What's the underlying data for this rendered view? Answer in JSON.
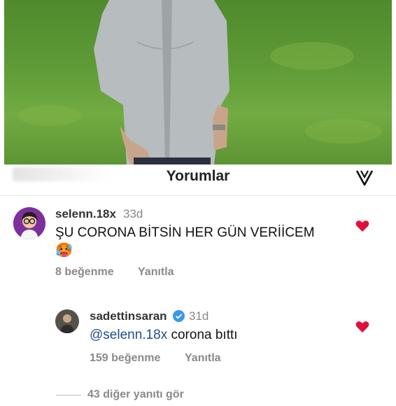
{
  "header": {
    "title": "Yorumlar"
  },
  "comments": [
    {
      "username": "selenn.18x",
      "age": "33d",
      "text": "ŞU CORONA BİTSİN HER GÜN VERİİCEM",
      "emoji": "🥵",
      "likes": "8 beğenme",
      "reply": "Yanıtla",
      "liked": true
    }
  ],
  "replies": [
    {
      "username": "sadettinsaran",
      "verified": true,
      "age": "31d",
      "mention": "@selenn.18x",
      "text": "corona bıttı",
      "likes": "159 beğenme",
      "reply": "Yanıtla",
      "liked": true
    }
  ],
  "more_replies": "43 diğer yanıtı gör",
  "colors": {
    "heart": "#e0103a",
    "verified": "#3897f0",
    "mention": "#1f4e8c"
  }
}
